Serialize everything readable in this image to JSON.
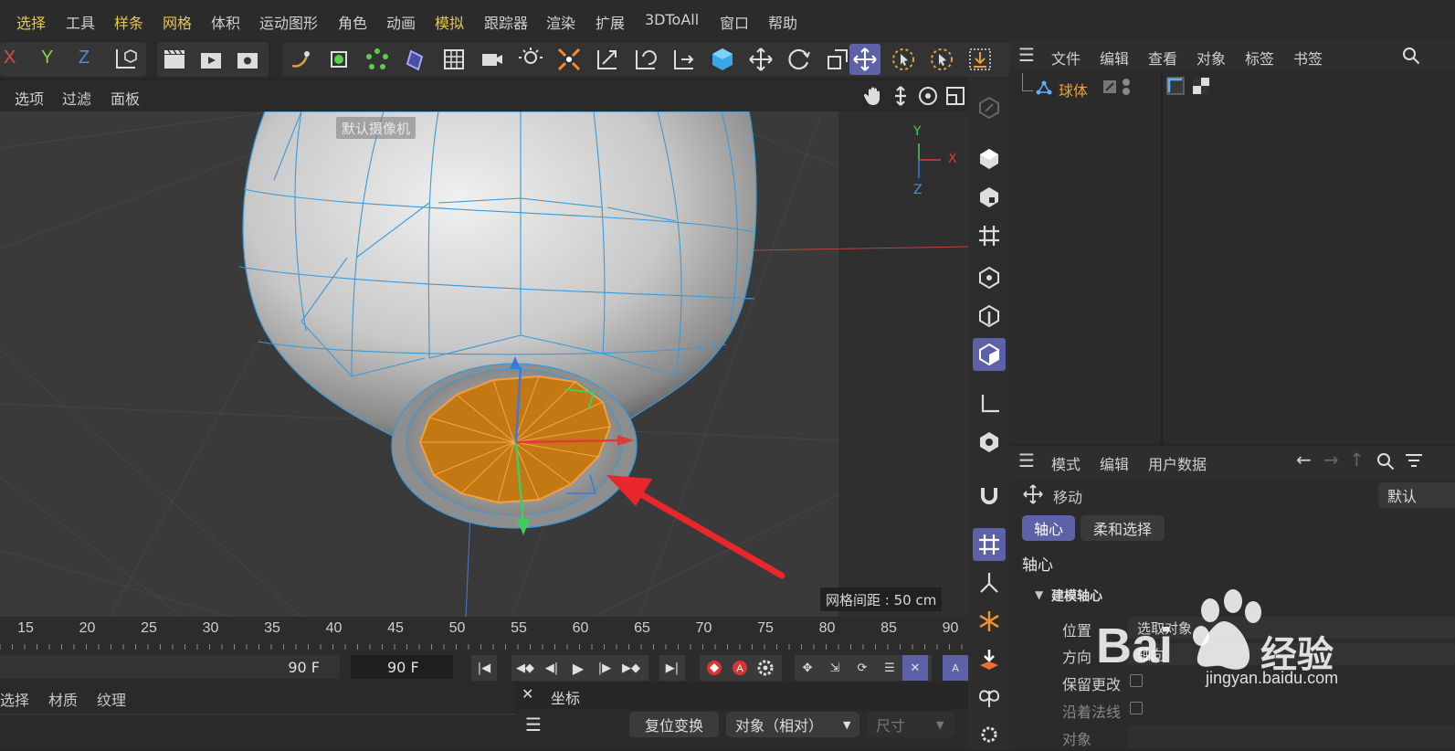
{
  "menubar": {
    "items": [
      "选择",
      "工具",
      "样条",
      "网格",
      "体积",
      "运动图形",
      "角色",
      "动画",
      "模拟",
      "跟踪器",
      "渲染",
      "扩展",
      "3DToAll",
      "窗口",
      "帮助"
    ],
    "highlighted": [
      "选择",
      "样条",
      "网格",
      "模拟"
    ]
  },
  "axes": {
    "x": "X",
    "y": "Y",
    "z": "Z"
  },
  "viewport": {
    "menu": [
      "选项",
      "过滤",
      "面板"
    ],
    "camera_label": "默认摄像机",
    "grid_label": "网格间距 : 50 cm",
    "axis_y": "Y",
    "axis_x": "X",
    "axis_z": "Z"
  },
  "timeline": {
    "ticks": [
      "15",
      "20",
      "25",
      "30",
      "35",
      "40",
      "45",
      "50",
      "55",
      "60",
      "65",
      "70",
      "75",
      "80",
      "85",
      "90"
    ],
    "end_frame": "90 F",
    "current_frame": "90 F"
  },
  "bottom_left_tabs": [
    "选择",
    "材质",
    "纹理"
  ],
  "coord_panel": {
    "title": "坐标",
    "reset_button": "复位变换",
    "mode_select": "对象（相对）",
    "size_select": "尺寸"
  },
  "object_manager": {
    "menu": [
      "文件",
      "编辑",
      "查看",
      "对象",
      "标签",
      "书签"
    ],
    "object_name": "球体"
  },
  "attribute_manager": {
    "menu": [
      "模式",
      "编辑",
      "用户数据"
    ],
    "tool_name": "移动",
    "preset": "默认",
    "tabs": [
      "轴心",
      "柔和选择"
    ],
    "section_title": "轴心",
    "group_title": "建模轴心",
    "properties": [
      {
        "label": "位置",
        "value": "选取对象"
      },
      {
        "label": "方向",
        "value": "轴向"
      },
      {
        "label": "保留更改",
        "value": ""
      },
      {
        "label": "沿着法线",
        "value": ""
      },
      {
        "label": "对象",
        "value": ""
      }
    ]
  },
  "watermark": {
    "brand": "Bai",
    "brand2": "经验",
    "url": "jingyan.baidu.com"
  },
  "colors": {
    "accent": "#5d62a8",
    "selection": "#e08a1e",
    "wire": "#3a9ad9",
    "arrow": "#e8262c",
    "menu_highlight": "#e6c84a"
  }
}
